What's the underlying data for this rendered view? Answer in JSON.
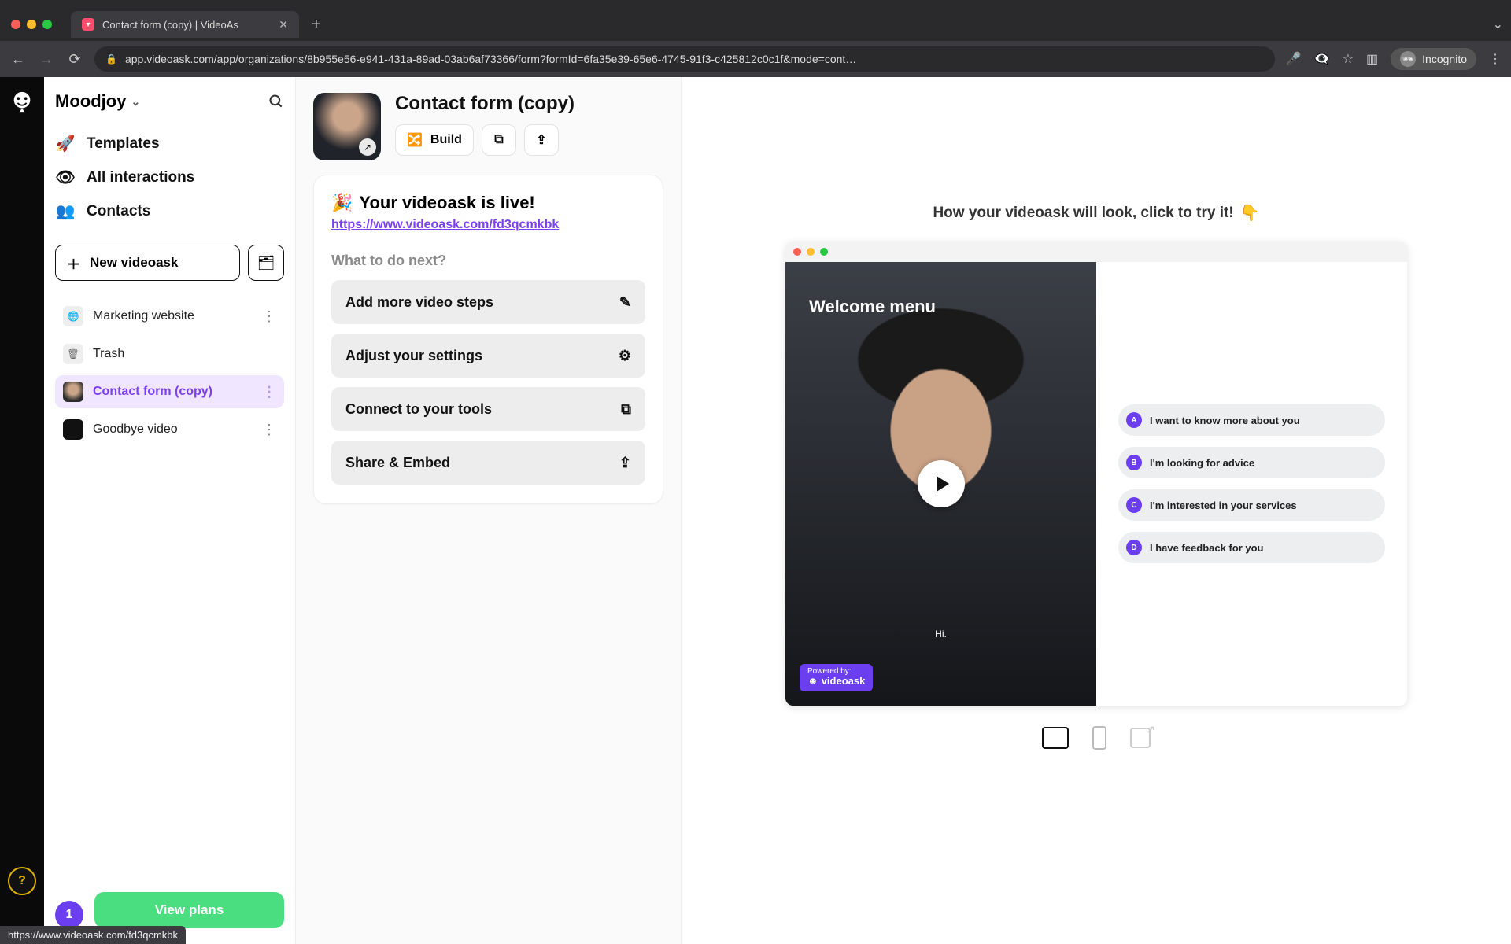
{
  "browser": {
    "tab_title": "Contact form (copy) | VideoAs",
    "url": "app.videoask.com/app/organizations/8b955e56-e941-431a-89ad-03ab6af73366/form?formId=6fa35e39-65e6-4745-91f3-c425812c0c1f&mode=cont…",
    "incognito_label": "Incognito",
    "status_url": "https://www.videoask.com/fd3qcmkbk"
  },
  "workspace": {
    "name": "Moodjoy"
  },
  "nav": {
    "templates": "Templates",
    "interactions": "All interactions",
    "contacts": "Contacts",
    "new_videoask": "New videoask"
  },
  "videos": [
    {
      "label": "Marketing website",
      "kind": "globe"
    },
    {
      "label": "Trash",
      "kind": "trash"
    },
    {
      "label": "Contact form (copy)",
      "kind": "face",
      "active": true
    },
    {
      "label": "Goodbye video",
      "kind": "dark"
    }
  ],
  "sidebar_bottom": {
    "badge": "1",
    "view_plans": "View plans"
  },
  "mid": {
    "title": "Contact form (copy)",
    "build": "Build",
    "live_heading": "Your videoask is live!",
    "live_emoji": "🎉",
    "live_link": "https://www.videoask.com/fd3qcmkbk",
    "next_heading": "What to do next?",
    "actions": {
      "add_steps": "Add more video steps",
      "adjust": "Adjust your settings",
      "connect": "Connect to your tools",
      "share": "Share & Embed"
    }
  },
  "preview": {
    "try_text": "How your videoask will look, click to try it!",
    "welcome": "Welcome menu",
    "caption": "Hi.",
    "powered_small": "Powered by:",
    "powered_brand": "videoask",
    "options": [
      {
        "letter": "A",
        "label": "I want to know more about you"
      },
      {
        "letter": "B",
        "label": "I'm looking for advice"
      },
      {
        "letter": "C",
        "label": "I'm interested in your services"
      },
      {
        "letter": "D",
        "label": "I have feedback for you"
      }
    ]
  }
}
